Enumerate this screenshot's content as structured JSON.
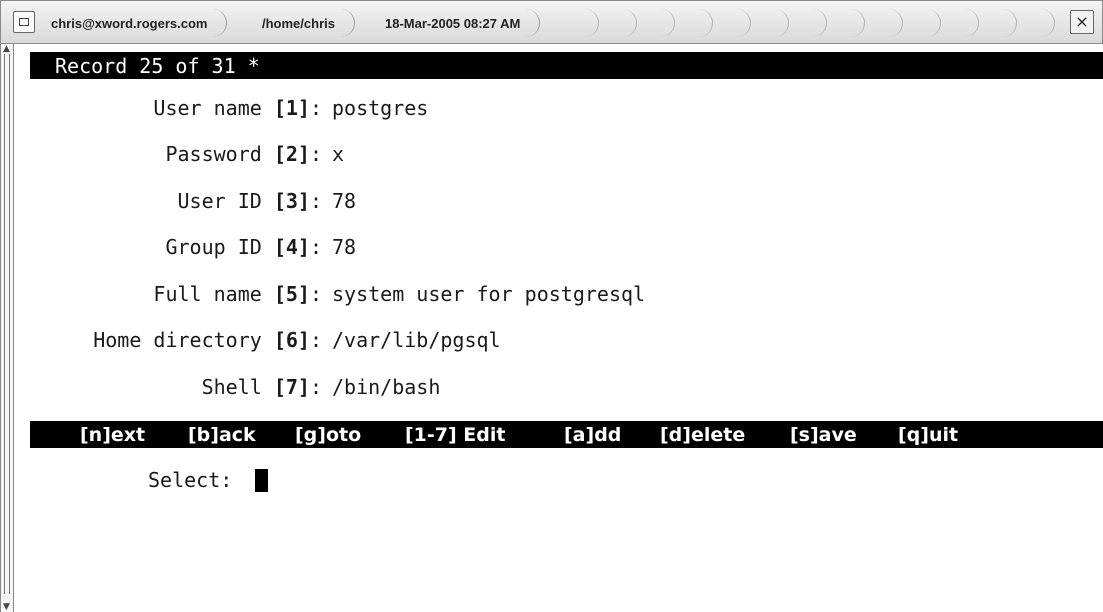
{
  "titlebar": {
    "tabs": [
      "chris@xword.rogers.com",
      "/home/chris",
      "18-Mar-2005 08:27 AM"
    ],
    "close_label": "×"
  },
  "header": {
    "record": "Record 25 of 31",
    "modified_marker": "*"
  },
  "fields": [
    {
      "label": "User name",
      "key": "[1]",
      "value": "postgres"
    },
    {
      "label": "Password",
      "key": "[2]",
      "value": "x"
    },
    {
      "label": "User ID",
      "key": "[3]",
      "value": "78"
    },
    {
      "label": "Group ID",
      "key": "[4]",
      "value": "78"
    },
    {
      "label": "Full name",
      "key": "[5]",
      "value": "system user for postgresql"
    },
    {
      "label": "Home directory",
      "key": "[6]",
      "value": "/var/lib/pgsql"
    },
    {
      "label": "Shell",
      "key": "[7]",
      "value": "/bin/bash"
    }
  ],
  "menu": [
    "[n]ext",
    "[b]ack",
    "[g]oto",
    "[1-7] Edit",
    "[a]dd",
    "[d]elete",
    "[s]ave",
    "[q]uit"
  ],
  "prompt": {
    "label": "Select:"
  }
}
